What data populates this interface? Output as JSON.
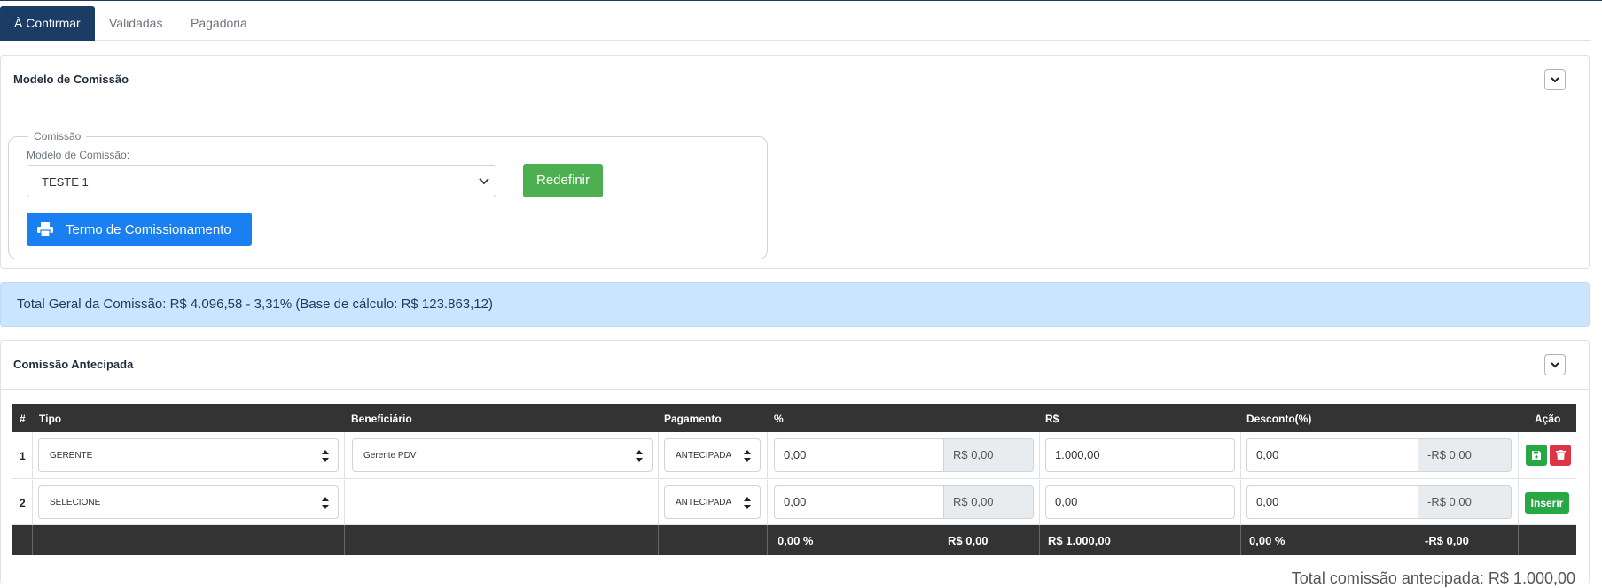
{
  "tabs": [
    {
      "label": "À Confirmar",
      "active": true
    },
    {
      "label": "Validadas",
      "active": false
    },
    {
      "label": "Pagadoria",
      "active": false
    }
  ],
  "modelo_card": {
    "title": "Modelo de Comissão",
    "fieldset_legend": "Comissão",
    "select_label": "Modelo de Comissão:",
    "select_value": "TESTE 1",
    "redefinir_label": "Redefinir",
    "termo_label": "Termo de Comissionamento"
  },
  "alert": {
    "text": "Total Geral da Comissão: R$ 4.096,58 - 3,31% (Base de cálculo: R$ 123.863,12)"
  },
  "antecipada_card": {
    "title": "Comissão Antecipada",
    "table": {
      "headers": [
        "#",
        "Tipo",
        "Beneficiário",
        "Pagamento",
        "%",
        "R$",
        "Desconto(%)",
        "Ação"
      ],
      "rows": [
        {
          "num": "1",
          "tipo": "GERENTE",
          "beneficiario": "Gerente PDV",
          "pagamento": "ANTECIPADA",
          "percent": "0,00",
          "percent_rs": "R$ 0,00",
          "rs": "1.000,00",
          "desconto": "0,00",
          "desconto_rs": "-R$ 0,00"
        },
        {
          "num": "2",
          "tipo": "SELECIONE",
          "beneficiario": "",
          "pagamento": "ANTECIPADA",
          "percent": "0,00",
          "percent_rs": "R$ 0,00",
          "rs": "0,00",
          "desconto": "0,00",
          "desconto_rs": "-R$ 0,00",
          "action_label": "Inserir"
        }
      ],
      "footer": {
        "percent_total": "0,00 %",
        "percent_rs_total": "R$ 0,00",
        "rs_total": "R$ 1.000,00",
        "desconto_total": "0,00 %",
        "desconto_rs_total": "-R$ 0,00"
      }
    },
    "total_antecipada": "Total comissão antecipada: R$ 1.000,00"
  },
  "colors": {
    "tab_active": "#1b3c64",
    "button_green": "#4caf50",
    "button_blue": "#1a7ff0",
    "alert_bg": "#cce5ff",
    "table_header": "#333333",
    "delete_red": "#dc3545",
    "save_green": "#28a745"
  },
  "icons": {
    "collapse": "chevron-down-icon",
    "print": "printer-icon",
    "save": "floppy-disk-icon",
    "delete": "trash-icon",
    "select_arrows": "up-down-arrows-icon"
  }
}
